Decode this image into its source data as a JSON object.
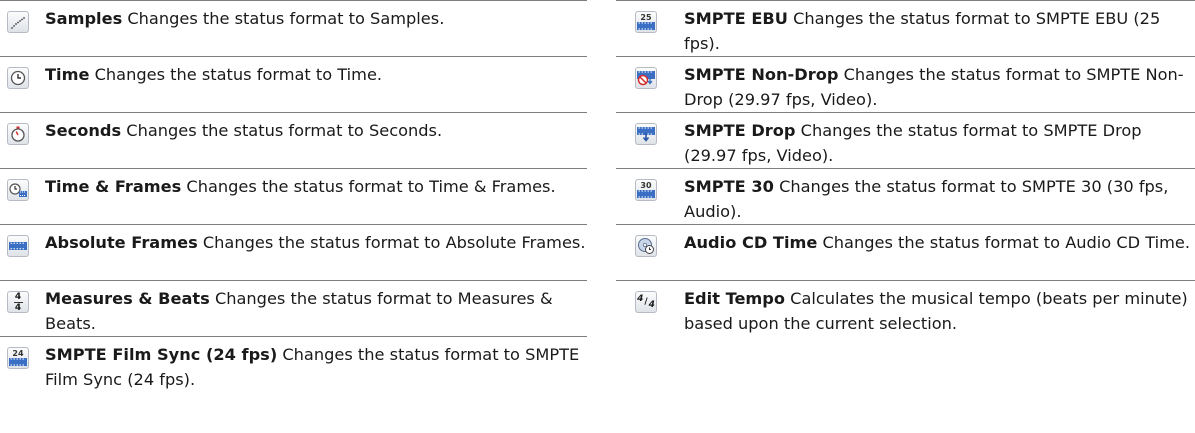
{
  "left_items": [
    {
      "icon": "samples-icon",
      "term": "Samples",
      "description": "Changes the status format to Samples."
    },
    {
      "icon": "clock-icon",
      "term": "Time",
      "description": "Changes the status format to Time."
    },
    {
      "icon": "stopwatch-icon",
      "term": "Seconds",
      "description": "Changes the status format to Seconds."
    },
    {
      "icon": "time-frames-icon",
      "term": "Time & Frames",
      "description": "Changes the status format to Time & Frames."
    },
    {
      "icon": "absolute-frames-icon",
      "term": "Absolute Frames",
      "description": "Changes the status format to Absolute Frames."
    },
    {
      "icon": "measures-beats-icon",
      "term": "Measures & Beats",
      "description": "Changes the status format to Measures & Beats."
    },
    {
      "icon": "smpte-24-icon",
      "term": "SMPTE Film Sync (24 fps)",
      "description": "Changes the status format to SMPTE Film Sync (24 fps)."
    }
  ],
  "right_items": [
    {
      "icon": "smpte-25-icon",
      "term": "SMPTE EBU",
      "description": "Changes the status format to SMPTE EBU (25 fps)."
    },
    {
      "icon": "smpte-non-drop-icon",
      "term": "SMPTE Non-Drop",
      "description": "Changes the status format to SMPTE Non-Drop (29.97 fps, Video)."
    },
    {
      "icon": "smpte-drop-icon",
      "term": "SMPTE Drop",
      "description": "Changes the status format to SMPTE Drop (29.97 fps, Video)."
    },
    {
      "icon": "smpte-30-icon",
      "term": "SMPTE 30",
      "description": "Changes the status format to SMPTE 30 (30 fps, Audio)."
    },
    {
      "icon": "audio-cd-time-icon",
      "term": "Audio CD Time",
      "description": "Changes the status format to Audio CD Time."
    },
    {
      "icon": "edit-tempo-icon",
      "term": "Edit Tempo",
      "description": "Calculates the musical tempo (beats per minute) based upon the current selection."
    }
  ],
  "icon_labels": {
    "measures_fraction": [
      "4",
      "4"
    ],
    "tempo_fraction": [
      "4",
      "4"
    ],
    "smpte_24": "24",
    "smpte_25": "25",
    "smpte_30": "30"
  },
  "colors": {
    "rule": "#7d7d7d",
    "icon_blue": "#3b6fc4",
    "icon_red": "#d22c2c"
  }
}
